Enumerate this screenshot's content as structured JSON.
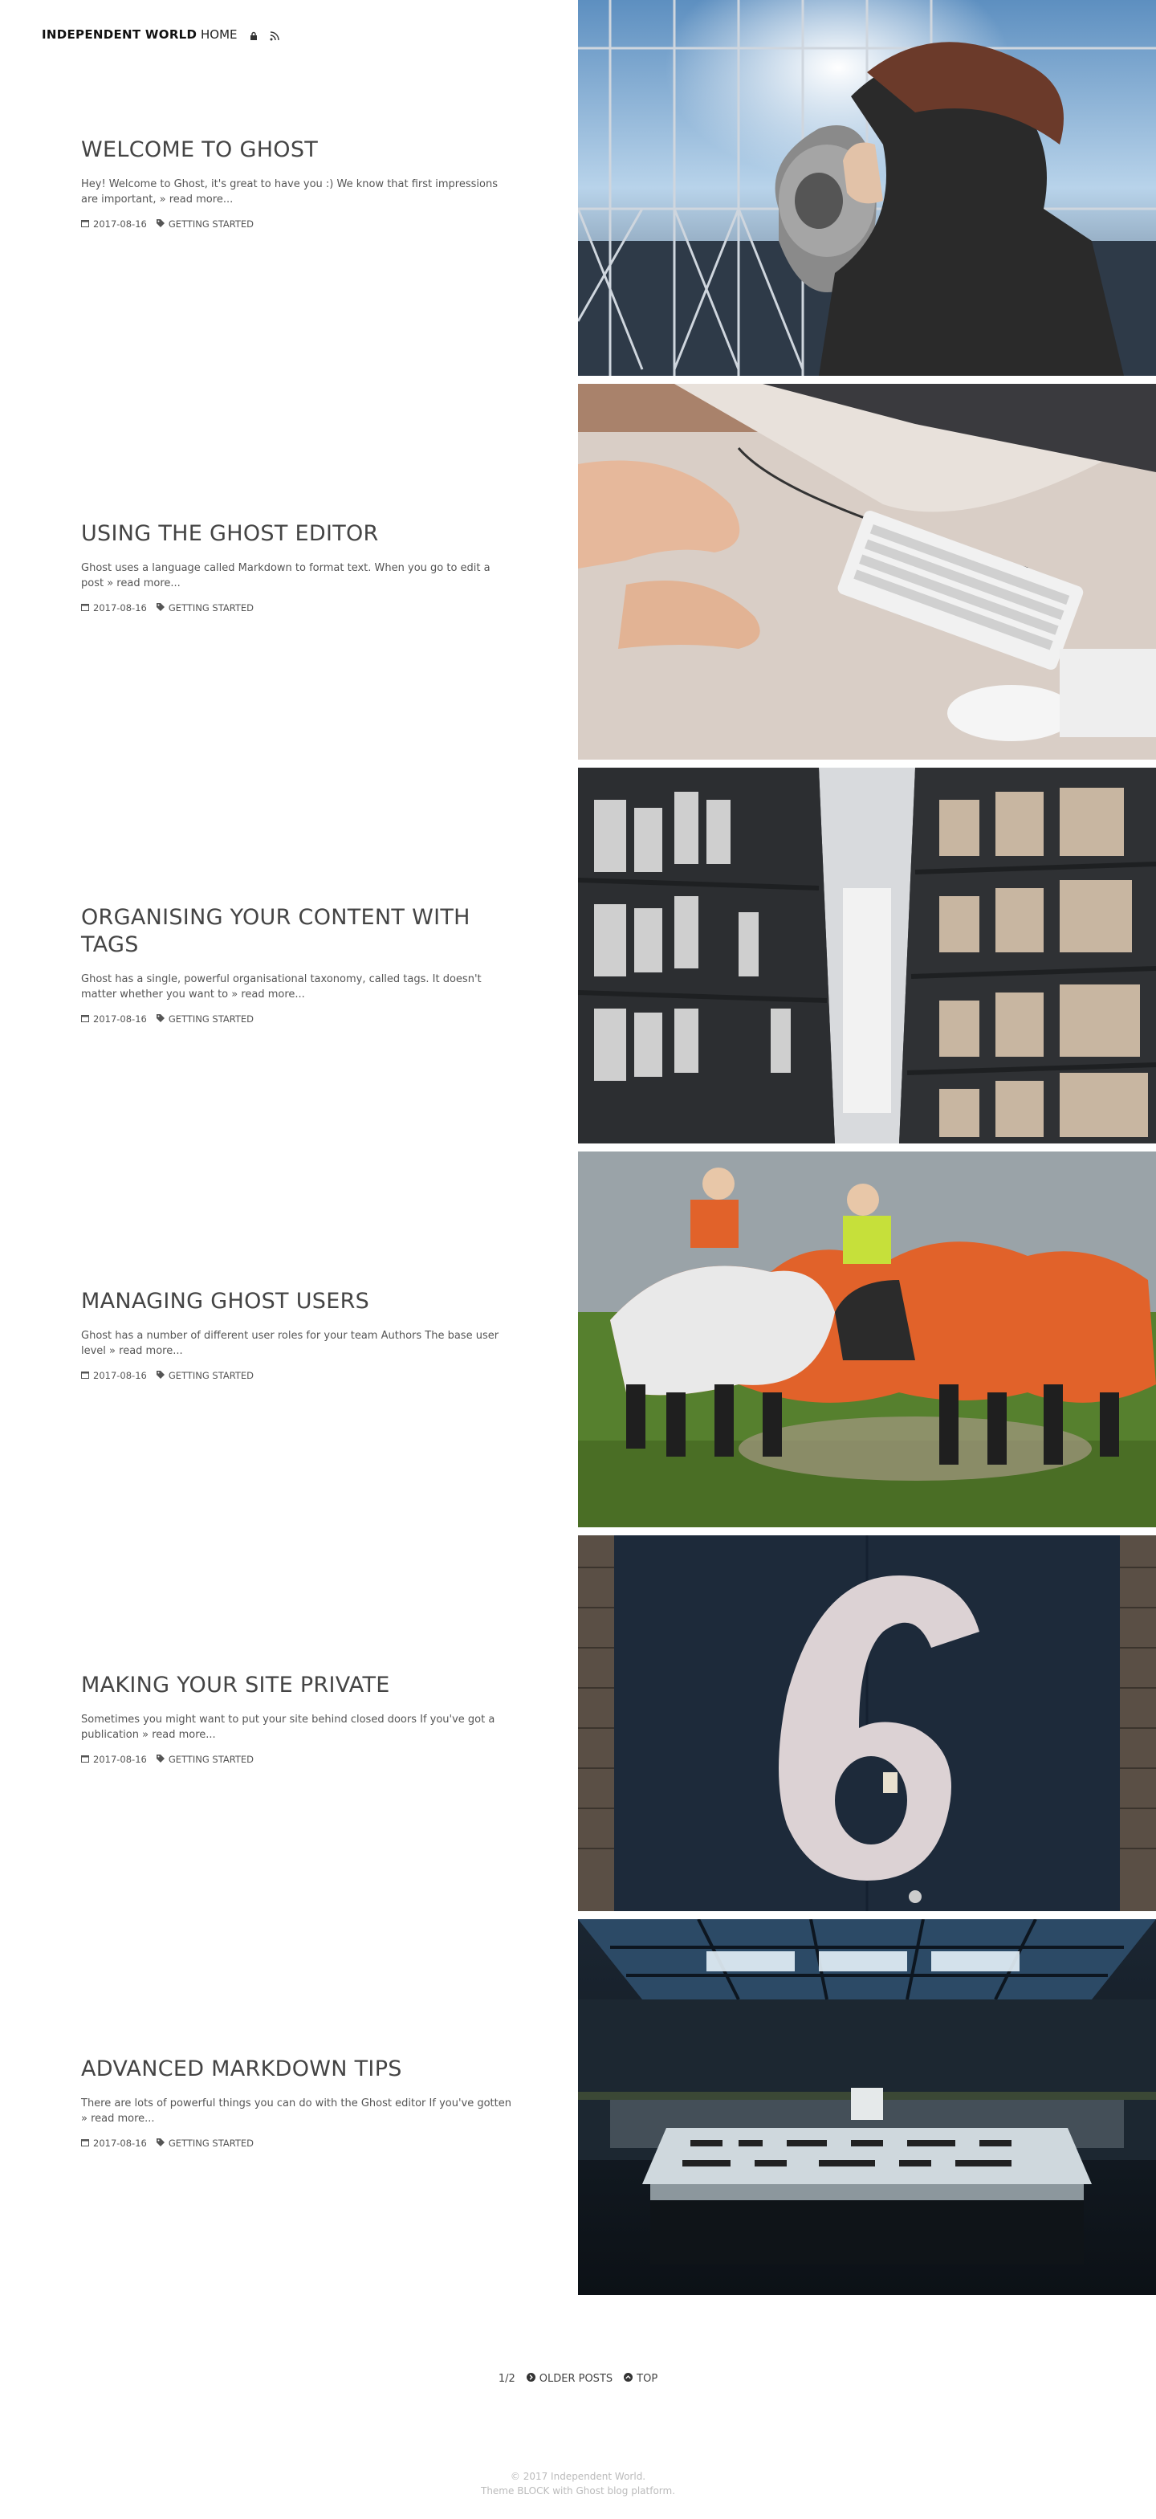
{
  "header": {
    "brand": "INDEPENDENT WORLD",
    "nav_home": "HOME",
    "icons": [
      "lock-icon",
      "rss-icon"
    ]
  },
  "posts": [
    {
      "title": "WELCOME TO GHOST",
      "excerpt": "Hey! Welcome to Ghost, it's great to have you :) We know that first impressions are important, » read more...",
      "date": "2017-08-16",
      "tag": "GETTING STARTED",
      "image": "city observation binoculars"
    },
    {
      "title": "USING THE GHOST EDITOR",
      "excerpt": "Ghost uses a language called Markdown to format text. When you go to edit a post » read more...",
      "date": "2017-08-16",
      "tag": "GETTING STARTED",
      "image": "hands typing on keyboard"
    },
    {
      "title": "ORGANISING YOUR CONTENT WITH TAGS",
      "excerpt": "Ghost has a single, powerful organisational taxonomy, called tags. It doesn't matter whether you want to » read more...",
      "date": "2017-08-16",
      "tag": "GETTING STARTED",
      "image": "archive shelves"
    },
    {
      "title": "MANAGING GHOST USERS",
      "excerpt": "Ghost has a number of different user roles for your team Authors The base user level » read more...",
      "date": "2017-08-16",
      "tag": "GETTING STARTED",
      "image": "rugby scrum"
    },
    {
      "title": "MAKING YOUR SITE PRIVATE",
      "excerpt": "Sometimes you might want to put your site behind closed doors If you've got a publication » read more...",
      "date": "2017-08-16",
      "tag": "GETTING STARTED",
      "image": "number six door"
    },
    {
      "title": "ADVANCED MARKDOWN TIPS",
      "excerpt": "There are lots of powerful things you can do with the Ghost editor If you've gotten » read more...",
      "date": "2017-08-16",
      "tag": "GETTING STARTED",
      "image": "control room"
    }
  ],
  "pagination": {
    "page": "1/2",
    "older": "OLDER POSTS",
    "top": "TOP"
  },
  "footer": {
    "copyright": "© 2017 Independent World.",
    "theme": "Theme BLOCK with Ghost blog platform."
  },
  "colors": {
    "text": "#444444",
    "footer_text": "#bbbbbb",
    "background": "#ffffff"
  }
}
